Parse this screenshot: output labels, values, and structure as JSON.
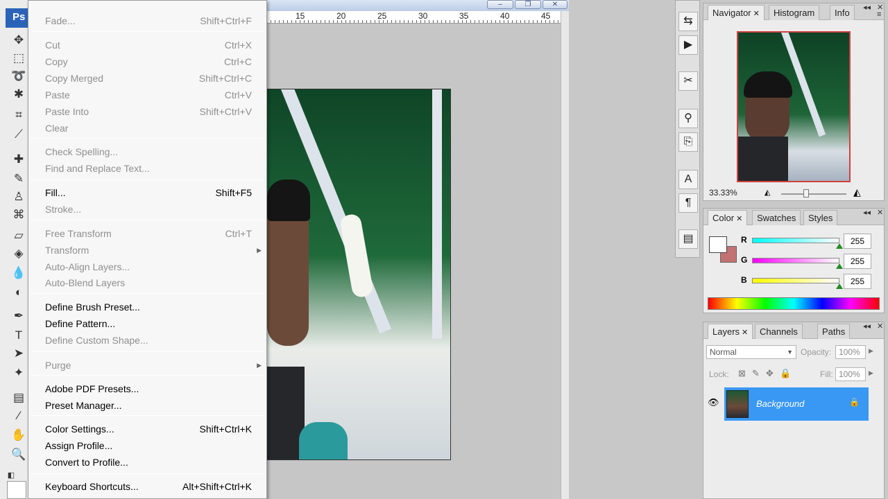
{
  "app": {
    "logo": "Ps"
  },
  "menu": {
    "items": [
      {
        "label": "Fade...",
        "shortcut": "Shift+Ctrl+F",
        "disabled": true
      },
      {
        "label": "Cut",
        "shortcut": "Ctrl+X",
        "disabled": true
      },
      {
        "label": "Copy",
        "shortcut": "Ctrl+C",
        "disabled": true
      },
      {
        "label": "Copy Merged",
        "shortcut": "Shift+Ctrl+C",
        "disabled": true
      },
      {
        "label": "Paste",
        "shortcut": "Ctrl+V",
        "disabled": true
      },
      {
        "label": "Paste Into",
        "shortcut": "Shift+Ctrl+V",
        "disabled": true
      },
      {
        "label": "Clear",
        "shortcut": "",
        "disabled": true
      },
      {
        "label": "Check Spelling...",
        "shortcut": "",
        "disabled": true
      },
      {
        "label": "Find and Replace Text...",
        "shortcut": "",
        "disabled": true
      },
      {
        "label": "Fill...",
        "shortcut": "Shift+F5",
        "disabled": false
      },
      {
        "label": "Stroke...",
        "shortcut": "",
        "disabled": true
      },
      {
        "label": "Free Transform",
        "shortcut": "Ctrl+T",
        "disabled": true
      },
      {
        "label": "Transform",
        "shortcut": "",
        "disabled": true,
        "submenu": true
      },
      {
        "label": "Auto-Align Layers...",
        "shortcut": "",
        "disabled": true
      },
      {
        "label": "Auto-Blend Layers",
        "shortcut": "",
        "disabled": true
      },
      {
        "label": "Define Brush Preset...",
        "shortcut": "",
        "disabled": false
      },
      {
        "label": "Define Pattern...",
        "shortcut": "",
        "disabled": false
      },
      {
        "label": "Define Custom Shape...",
        "shortcut": "",
        "disabled": true
      },
      {
        "label": "Purge",
        "shortcut": "",
        "disabled": true,
        "submenu": true
      },
      {
        "label": "Adobe PDF Presets...",
        "shortcut": "",
        "disabled": false
      },
      {
        "label": "Preset Manager...",
        "shortcut": "",
        "disabled": false
      },
      {
        "label": "Color Settings...",
        "shortcut": "Shift+Ctrl+K",
        "disabled": false
      },
      {
        "label": "Assign Profile...",
        "shortcut": "",
        "disabled": false
      },
      {
        "label": "Convert to Profile...",
        "shortcut": "",
        "disabled": false
      },
      {
        "label": "Keyboard Shortcuts...",
        "shortcut": "Alt+Shift+Ctrl+K",
        "disabled": false
      }
    ]
  },
  "document": {
    "ruler_numbers": [
      "15",
      "20",
      "25",
      "30",
      "35",
      "40",
      "45"
    ],
    "window_buttons": [
      "–",
      "❐",
      "✕"
    ]
  },
  "navigator": {
    "tabs": [
      "Navigator",
      "Histogram",
      "Info"
    ],
    "zoom": "33.33%",
    "zoom_slider_fraction": 0.38
  },
  "color": {
    "tabs": [
      "Color",
      "Swatches",
      "Styles"
    ],
    "channels": [
      {
        "label": "R",
        "value": "255"
      },
      {
        "label": "G",
        "value": "255"
      },
      {
        "label": "B",
        "value": "255"
      }
    ],
    "foreground": "#ffffff",
    "background": "#c27272"
  },
  "layers": {
    "tabs": [
      "Layers",
      "Channels",
      "Paths"
    ],
    "blend_mode": "Normal",
    "opacity_label": "Opacity:",
    "opacity": "100%",
    "lock_label": "Lock:",
    "fill_label": "Fill:",
    "fill": "100%",
    "layer_name": "Background",
    "selected_color": "#3a98f5"
  }
}
